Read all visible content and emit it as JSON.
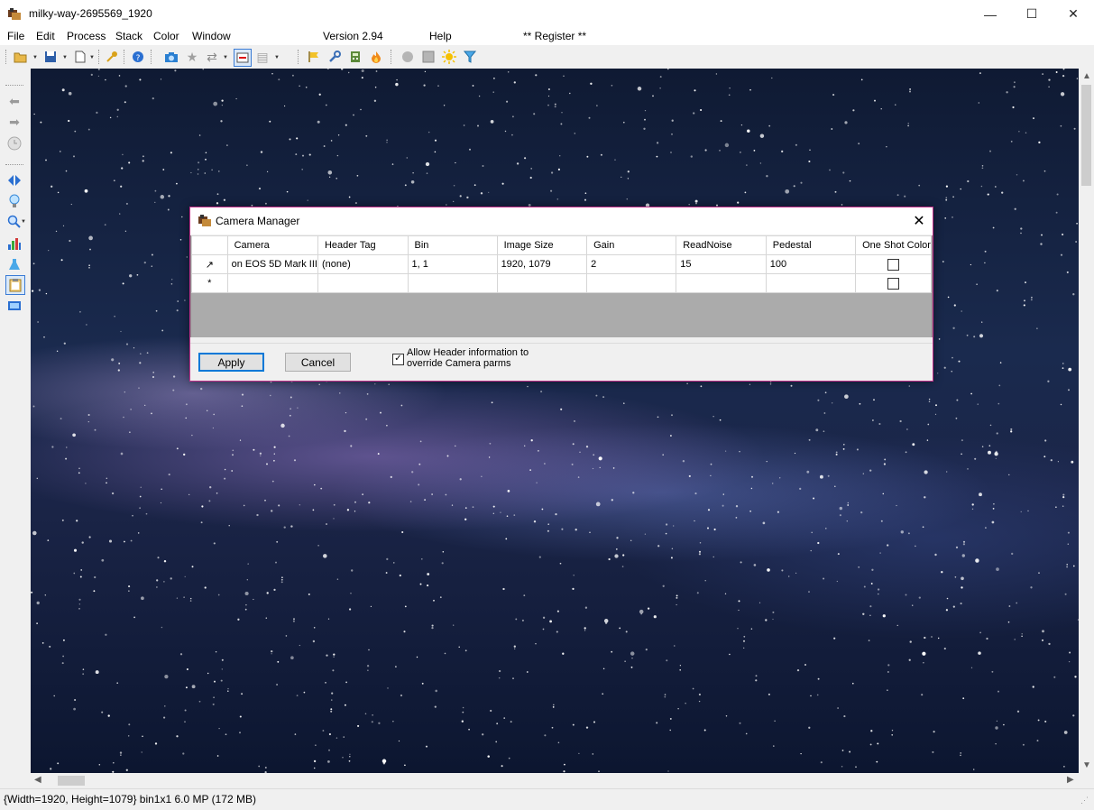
{
  "window": {
    "title": "milky-way-2695569_1920",
    "minimize": "—",
    "maximize": "☐",
    "close": "✕"
  },
  "menu": {
    "file": "File",
    "edit": "Edit",
    "process": "Process",
    "stack": "Stack",
    "color": "Color",
    "window": "Window",
    "version": "Version 2.94",
    "help": "Help",
    "register": "** Register **"
  },
  "status": {
    "text": "{Width=1920, Height=1079} bin1x1  6.0 MP (172 MB)"
  },
  "dialog": {
    "title": "Camera Manager",
    "close": "✕",
    "columns": [
      "Camera",
      "Header Tag",
      "Bin",
      "Image Size",
      "Gain",
      "ReadNoise",
      "Pedestal",
      "One Shot Color"
    ],
    "rows": [
      {
        "marker": "↗",
        "camera": "on EOS 5D Mark III",
        "header_tag": "(none)",
        "bin": "1, 1",
        "image_size": "1920, 1079",
        "gain": "2",
        "read_noise": "15",
        "pedestal": "100",
        "one_shot_color": false
      }
    ],
    "new_row_marker": "*",
    "apply_label": "Apply",
    "cancel_label": "Cancel",
    "allow_header_label": "Allow Header information to override Camera parms",
    "allow_header_checked": true,
    "check_mark": "✓"
  }
}
